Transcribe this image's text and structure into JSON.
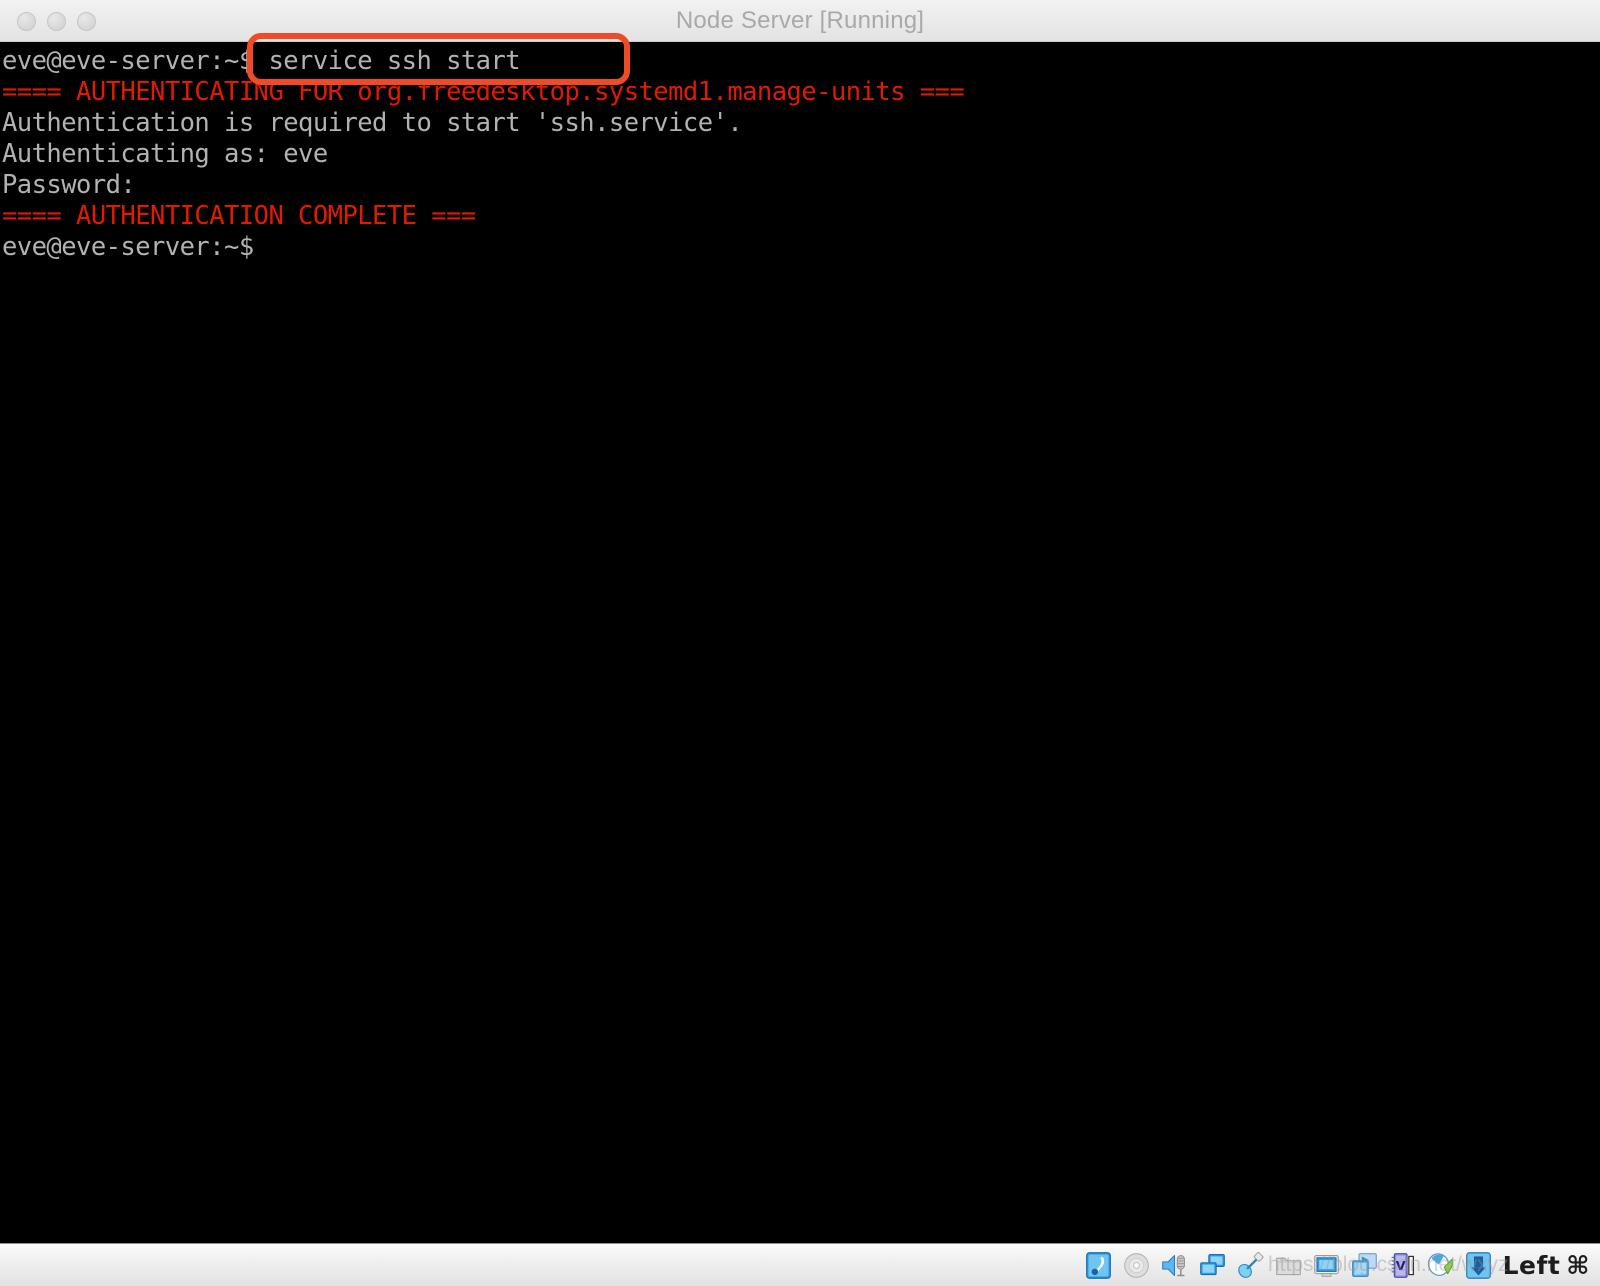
{
  "window": {
    "title": "Node Server [Running]",
    "traffic_lights": [
      "close",
      "minimize",
      "zoom"
    ]
  },
  "terminal": {
    "background_color": "#000000",
    "text_color": "#b2b2b2",
    "alert_color": "#e01b00",
    "lines": [
      {
        "text": "eve@eve-server:~$ service ssh start",
        "color": "normal"
      },
      {
        "text": "==== AUTHENTICATING FOR org.freedesktop.systemd1.manage-units ===",
        "color": "red"
      },
      {
        "text": "Authentication is required to start 'ssh.service'.",
        "color": "normal"
      },
      {
        "text": "Authenticating as: eve",
        "color": "normal"
      },
      {
        "text": "Password:",
        "color": "normal"
      },
      {
        "text": "==== AUTHENTICATION COMPLETE ===",
        "color": "red"
      },
      {
        "text": "eve@eve-server:~$",
        "color": "normal"
      }
    ]
  },
  "annotation": {
    "label": "service ssh start",
    "color": "#ef4b26"
  },
  "statusbar": {
    "icons": [
      {
        "name": "hard-disk-icon",
        "title": "Hard Disks"
      },
      {
        "name": "optical-disc-icon",
        "title": "Optical Drives"
      },
      {
        "name": "audio-icon",
        "title": "Audio"
      },
      {
        "name": "network-icon",
        "title": "Network"
      },
      {
        "name": "usb-icon",
        "title": "USB Devices"
      },
      {
        "name": "shared-folders-icon",
        "title": "Shared Folders"
      },
      {
        "name": "display-icon",
        "title": "Display"
      },
      {
        "name": "video-capture-icon",
        "title": "Video Capture"
      },
      {
        "name": "vm-features-icon",
        "title": "VM Features"
      },
      {
        "name": "mouse-integration-icon",
        "title": "Mouse Integration"
      },
      {
        "name": "host-drive-icon",
        "title": "Host Drive"
      }
    ],
    "host_key": "Left",
    "host_key_glyph": "⌘"
  },
  "watermark": {
    "text": "https://blog.csdn.net/wxyz"
  }
}
